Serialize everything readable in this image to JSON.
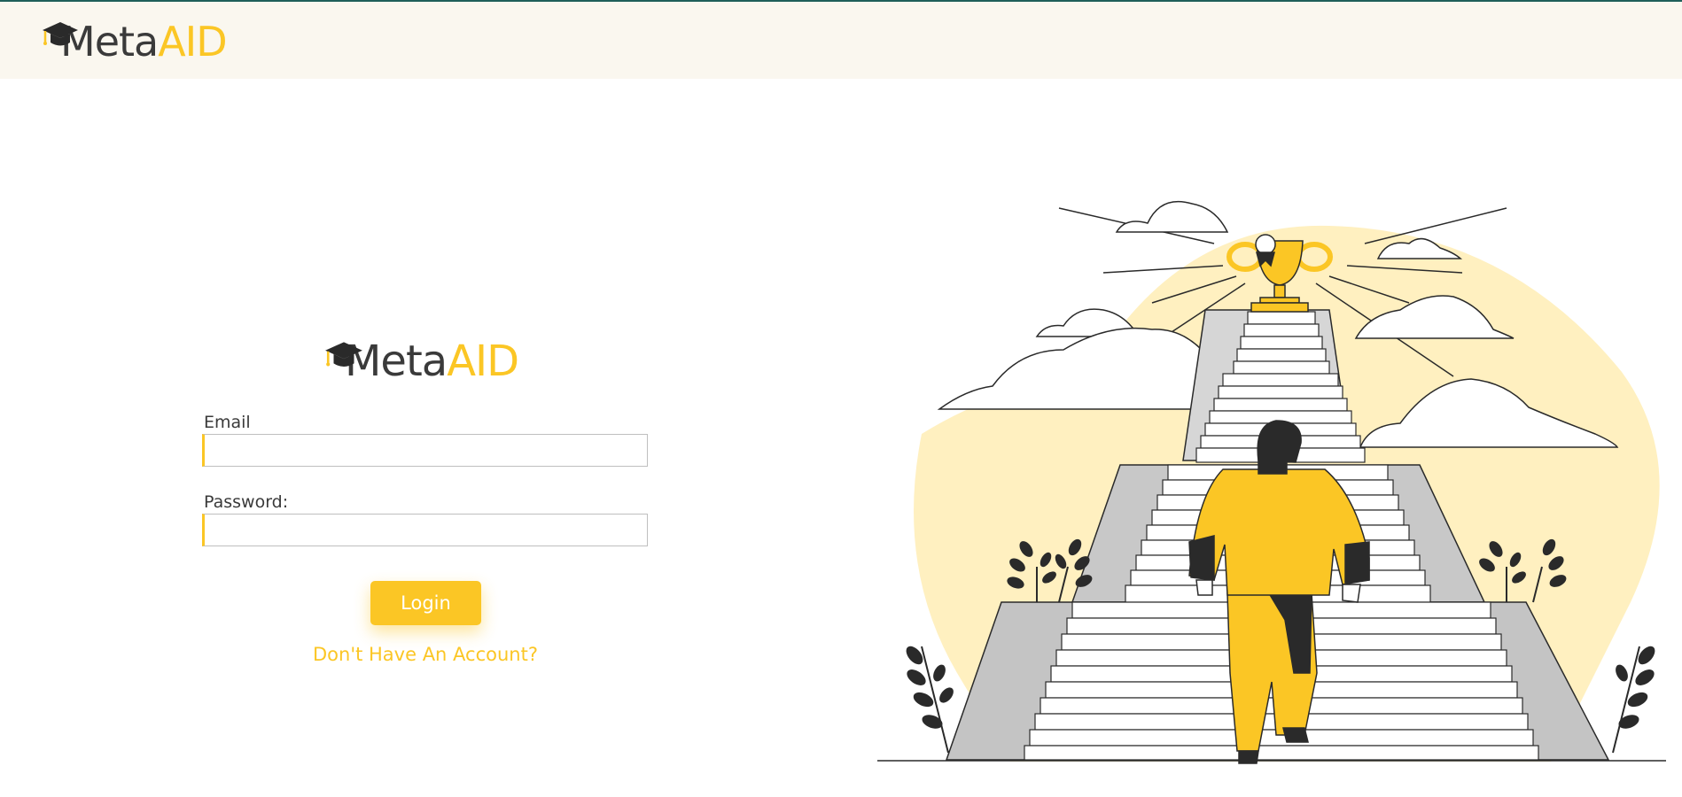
{
  "brand": {
    "part1": "Meta",
    "part2": "AID"
  },
  "form": {
    "email_label": "Email",
    "email_value": "",
    "password_label": "Password:",
    "password_value": "",
    "login_label": "Login",
    "register_link": "Don't Have An Account?"
  },
  "colors": {
    "accent": "#fbc625",
    "header_bg": "#faf7ef",
    "header_border": "#1f5f5a",
    "text_dark": "#3a3a3a"
  }
}
